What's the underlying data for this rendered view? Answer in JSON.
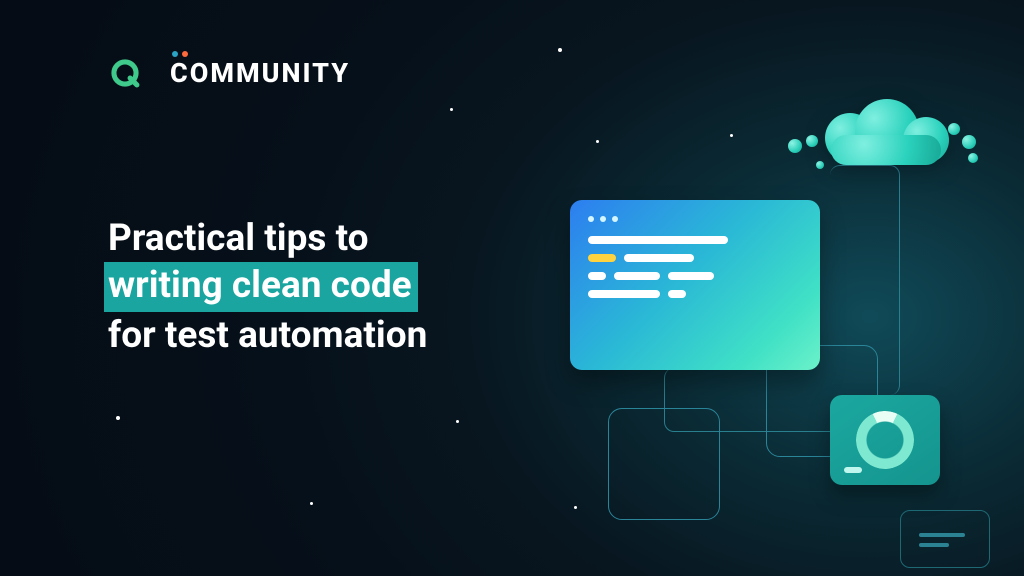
{
  "brand": {
    "logo_text": "COMMUNITY"
  },
  "title": {
    "line1": "Practical tips to",
    "line2_highlighted": "writing clean code",
    "line3": "for test automation"
  },
  "colors": {
    "accent_green": "#1aa5a0",
    "accent_blue": "#2aa3c4",
    "accent_orange": "#ff6a3d",
    "gradient_start": "#2d7ef0",
    "gradient_end": "#6bf2c9"
  }
}
